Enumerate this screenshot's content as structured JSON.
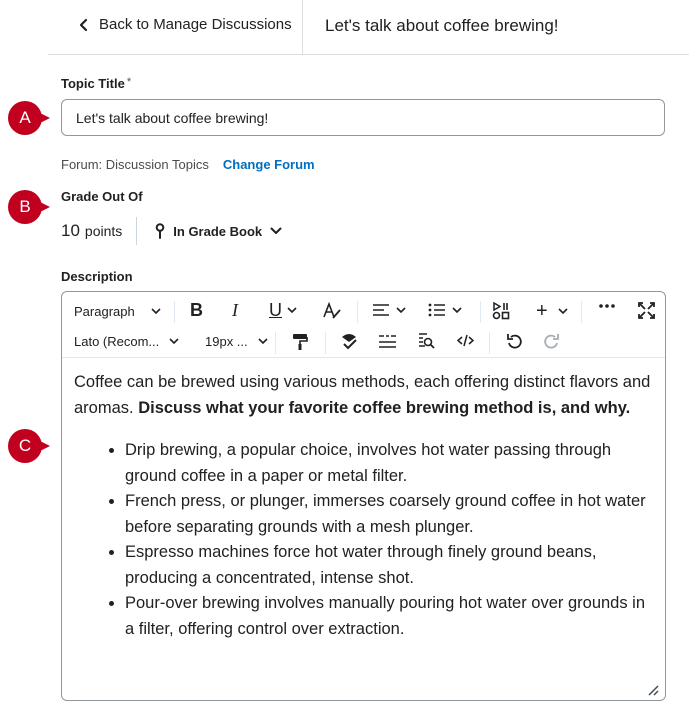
{
  "header": {
    "back_label": "Back to Manage Discussions",
    "title": "Let's talk about coffee brewing!"
  },
  "topic": {
    "label": "Topic Title",
    "required_marker": "*",
    "value": "Let's talk about coffee brewing!"
  },
  "forum": {
    "text": "Forum: Discussion Topics",
    "change_label": "Change Forum"
  },
  "grade": {
    "label": "Grade Out Of",
    "points_value": "10",
    "points_unit": "points",
    "gradebook_label": "In Grade Book"
  },
  "description": {
    "label": "Description",
    "toolbar": {
      "paragraph": "Paragraph",
      "font": "Lato (Recom...",
      "size": "19px ..."
    },
    "intro": "Coffee can be brewed using various methods, each offering distinct flavors and aromas. ",
    "intro_bold": "Discuss what your favorite coffee brewing method is, and why.",
    "bullets": [
      "Drip brewing, a popular choice, involves hot water passing through ground coffee in a paper or metal filter.",
      "French press, or plunger, immerses coarsely ground coffee in hot water before separating grounds with a mesh plunger.",
      "Espresso machines force hot water through finely ground beans, producing a concentrated, intense shot.",
      "Pour-over brewing involves manually pouring hot water over grounds in a filter, offering control over extraction."
    ]
  },
  "callouts": [
    "A",
    "B",
    "C"
  ],
  "colors": {
    "callout": "#c0001e",
    "link": "#006fbf",
    "border": "#90989d"
  }
}
